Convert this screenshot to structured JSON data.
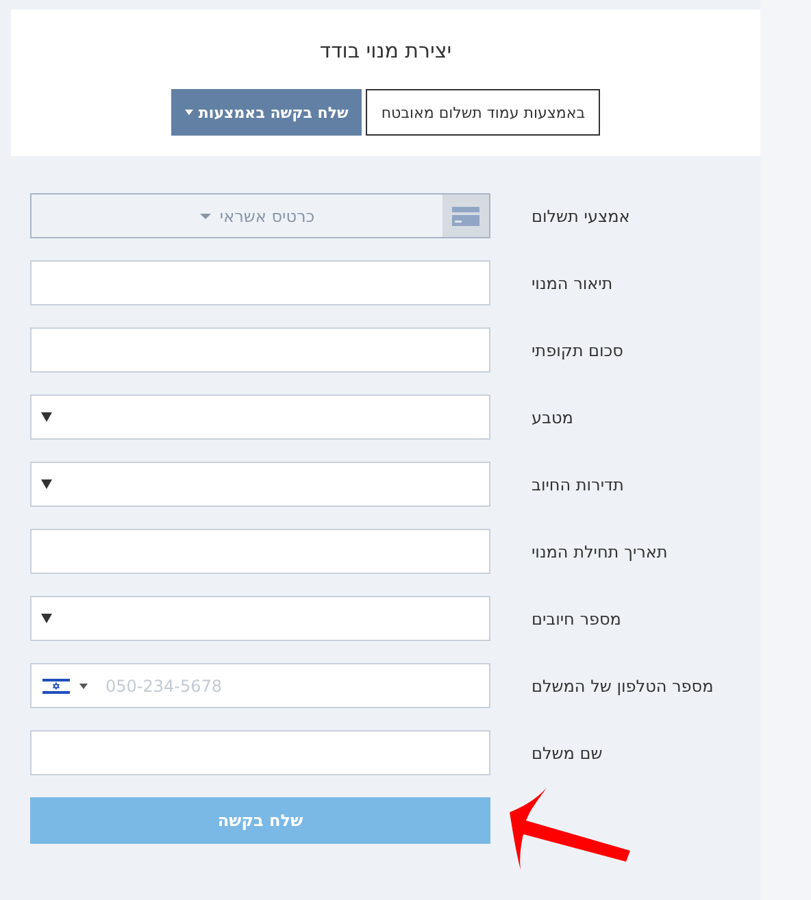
{
  "title": "יצירת מנוי בודד",
  "mode_buttons": [
    {
      "label": "באמצעות עמוד תשלום מאובטח",
      "kind": "outline"
    },
    {
      "label": "שלח בקשה באמצעות",
      "kind": "dropdown"
    }
  ],
  "fields": [
    {
      "label": "אמצעי תשלום",
      "kind": "payment",
      "value": "כרטיס אשראי"
    },
    {
      "label": "תיאור המנוי",
      "kind": "text"
    },
    {
      "label": "סכום תקופתי",
      "kind": "text"
    },
    {
      "label": "מטבע",
      "kind": "select"
    },
    {
      "label": "תדירות החיוב",
      "kind": "select"
    },
    {
      "label": "תאריך תחילת המנוי",
      "kind": "text"
    },
    {
      "label": "מספר חיובים",
      "kind": "select"
    },
    {
      "label": "מספר הטלפון של המשלם",
      "kind": "phone",
      "placeholder": "050-234-5678"
    },
    {
      "label": "שם משלם",
      "kind": "text"
    }
  ],
  "submit": {
    "label": "שלח בקשה"
  }
}
